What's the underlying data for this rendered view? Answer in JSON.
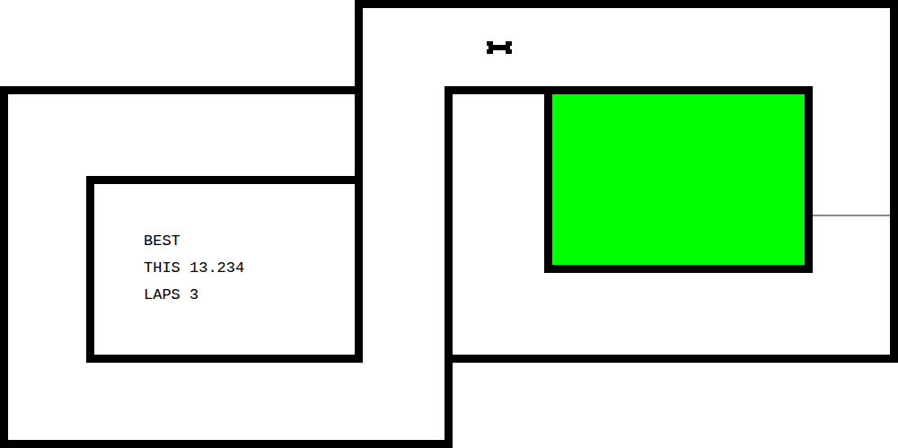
{
  "hud": [
    {
      "text": "BEST"
    },
    {
      "text": "THIS 13.234"
    },
    {
      "text": "LAPS 3"
    }
  ]
}
